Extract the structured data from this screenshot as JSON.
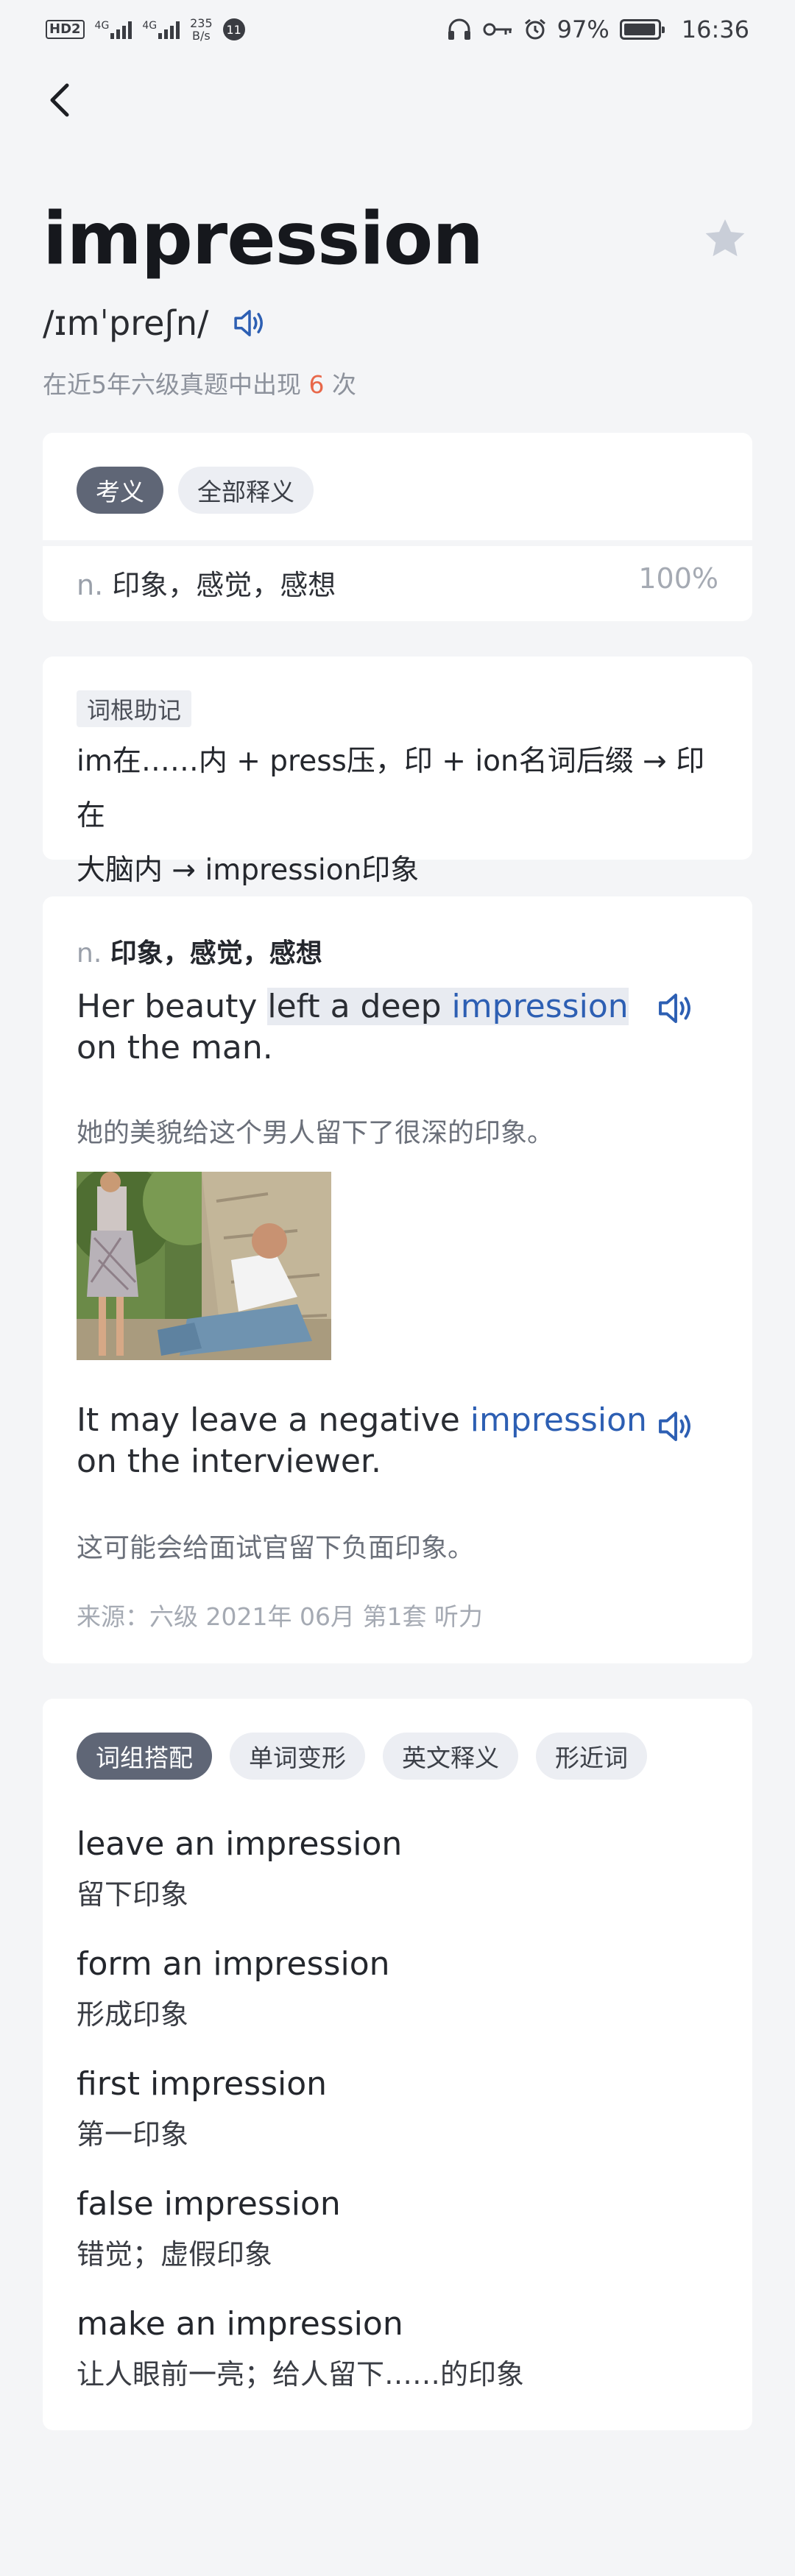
{
  "status_bar": {
    "hd": "HD",
    "hd_num": "2",
    "net1": "4G",
    "net2": "4G",
    "speed_value": "235",
    "speed_unit": "B/s",
    "notif": "11",
    "battery": "97%",
    "battery_level": 0.97,
    "time": "16:36"
  },
  "header": {
    "word": "impression",
    "phonetic": "/ɪmˈpreʃn/",
    "freq_prefix": "在近5年六级真题中出现 ",
    "freq_count": "6",
    "freq_suffix": " 次"
  },
  "meaning_card": {
    "tabs": [
      {
        "label": "考义",
        "active": true
      },
      {
        "label": "全部释义",
        "active": false
      }
    ],
    "pos": "n.",
    "definition": "印象，感觉，感想",
    "percent": "100%"
  },
  "mnemonic_card": {
    "tag": "词根助记",
    "line1": "im在……内 + press压，印 + ion名词后缀 → 印在",
    "line2": "大脑内 → impression印象"
  },
  "example_card": {
    "pos": "n.",
    "meaning": "印象，感觉，感想",
    "ex1": {
      "pre": "Her beauty ",
      "highlight": "left a deep ",
      "keyword": "impression",
      "post": "on the man.",
      "translation": "她的美貌给这个男人留下了很深的印象。"
    },
    "ex2": {
      "pre": "It may leave a negative ",
      "keyword": "impression",
      "post": "on the interviewer.",
      "translation": "这可能会给面试官留下负面印象。"
    },
    "source": "来源：六级 2021年 06月 第1套 听力"
  },
  "phrase_card": {
    "tabs": [
      {
        "label": "词组搭配",
        "active": true
      },
      {
        "label": "单词变形",
        "active": false
      },
      {
        "label": "英文释义",
        "active": false
      },
      {
        "label": "形近词",
        "active": false
      }
    ],
    "phrases": [
      {
        "en": "leave an impression",
        "zh": "留下印象"
      },
      {
        "en": "form an impression",
        "zh": "形成印象"
      },
      {
        "en": "first impression",
        "zh": "第一印象"
      },
      {
        "en": "false impression",
        "zh": "错觉；虚假印象"
      },
      {
        "en": "make an impression",
        "zh": "让人眼前一亮；给人留下……的印象"
      }
    ]
  },
  "colors": {
    "background": "#f4f5f7",
    "card": "#ffffff",
    "accent_blue": "#2d5fb3",
    "count_orange": "#e8684a",
    "active_pill": "#5f6676",
    "star": "#c9ced8"
  },
  "icons": [
    "back-arrow-icon",
    "star-icon",
    "speaker-icon",
    "headphones-icon",
    "key-icon",
    "alarm-icon",
    "battery-icon"
  ]
}
